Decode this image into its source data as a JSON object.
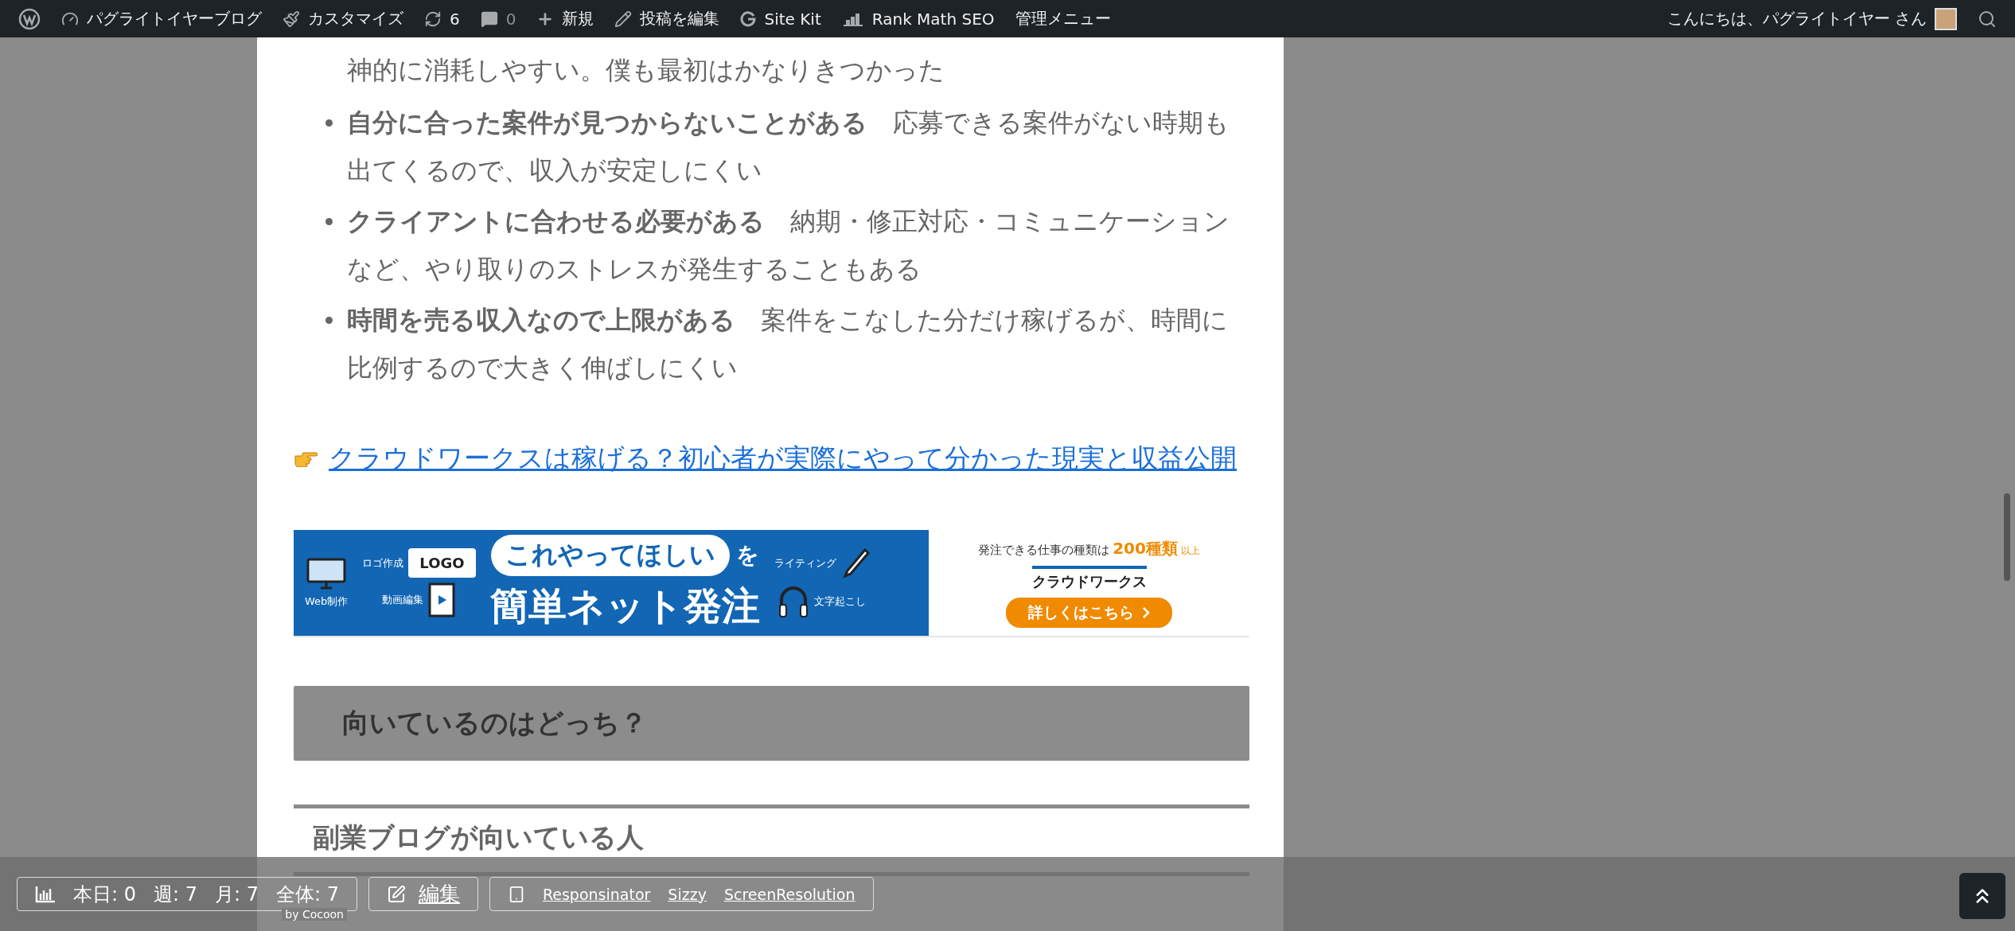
{
  "admin_bar": {
    "items": [
      {
        "kind": "wp-logo"
      },
      {
        "kind": "site",
        "label": "パグライトイヤーブログ"
      },
      {
        "kind": "customize",
        "label": "カスタマイズ"
      },
      {
        "kind": "updates",
        "label": "6"
      },
      {
        "kind": "comments",
        "label": "0"
      },
      {
        "kind": "new",
        "label": "新規"
      },
      {
        "kind": "edit",
        "label": "投稿を編集"
      },
      {
        "kind": "sitekit",
        "label": "Site Kit"
      },
      {
        "kind": "rankmath",
        "label": "Rank Math SEO"
      },
      {
        "kind": "menu",
        "label": "管理メニュー"
      }
    ],
    "greeting": "こんにちは、パグライトイヤー さん"
  },
  "article": {
    "lead_line": "神的に消耗しやすい。僕も最初はかなりきつかった",
    "list": [
      {
        "text": "**自分に合った案件が見つからないことがある**　応募できる案件がない時期も出てくるので、収入が安定しにくい"
      },
      {
        "text": "**クライアントに合わせる必要がある**　納期・修正対応・コミュニケーションなど、やり取りのストレスが発生することもある"
      },
      {
        "text": "**時間を売る収入なので上限がある**　案件をこなした分だけ稼げるが、時間に比例するので大きく伸ばしにくい"
      }
    ],
    "link": "クラウドワークスは稼げる？初心者が実際にやって分かった現実と収益公開",
    "banner": {
      "web": "Web制作",
      "logo_label": "ロゴ作成",
      "logo": "LOGO",
      "video": "動画編集",
      "bubble": "これやってほしい",
      "particle": "を",
      "headline": "簡単ネット発注",
      "writing": "ライティング",
      "transcribe": "文字起こし",
      "tagline": "発注できる仕事の種類は",
      "count": "200種類",
      "count_suffix": "以上",
      "brand": "クラウドワークス",
      "cta": "詳しくはこちら"
    },
    "h2": "向いているのはどっち？",
    "h3": "副業ブログが向いている人"
  },
  "footer": {
    "stats": [
      "本日: 0",
      "週: 7",
      "月: 7",
      "全体: 7"
    ],
    "credit": "by Cocoon",
    "edit": "編集",
    "tools": [
      "Responsinator",
      "Sizzy",
      "ScreenResolution"
    ]
  }
}
